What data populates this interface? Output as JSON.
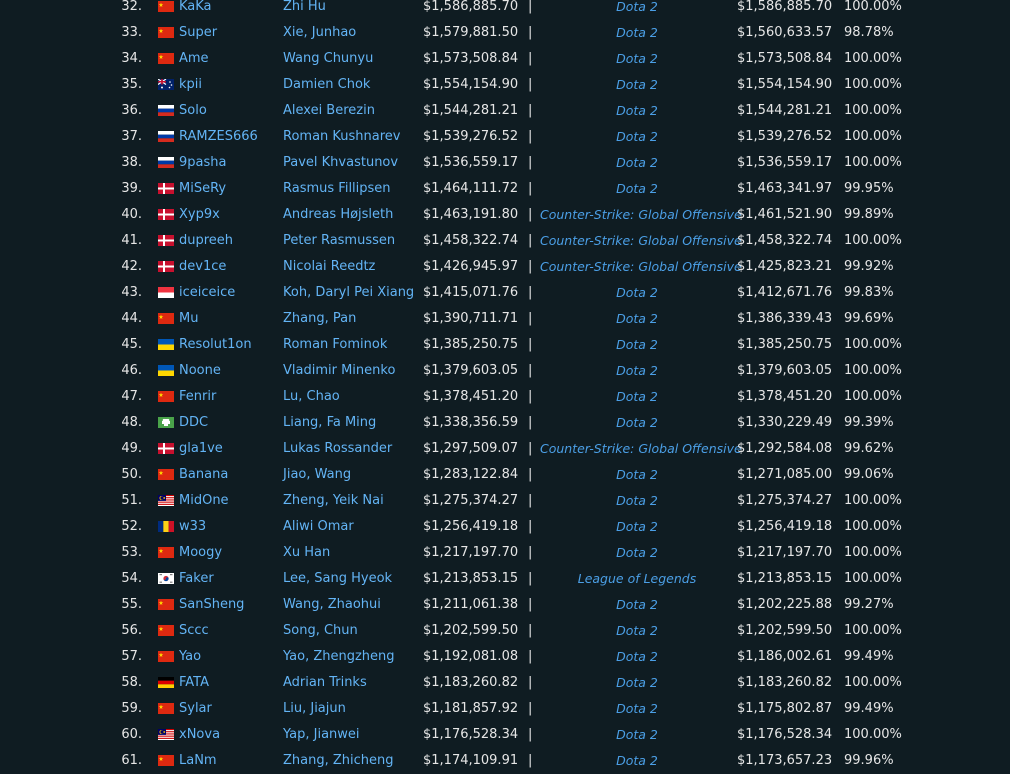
{
  "separator": "|",
  "players": [
    {
      "rank": "32.",
      "country": "cn",
      "handle": "KaKa",
      "name": "Zhi Hu",
      "total": "$1,586,885.70",
      "game": "Dota 2",
      "game_earnings": "$1,586,885.70",
      "percent": "100.00%"
    },
    {
      "rank": "33.",
      "country": "cn",
      "handle": "Super",
      "name": "Xie, Junhao",
      "total": "$1,579,881.50",
      "game": "Dota 2",
      "game_earnings": "$1,560,633.57",
      "percent": "98.78%"
    },
    {
      "rank": "34.",
      "country": "cn",
      "handle": "Ame",
      "name": "Wang Chunyu",
      "total": "$1,573,508.84",
      "game": "Dota 2",
      "game_earnings": "$1,573,508.84",
      "percent": "100.00%"
    },
    {
      "rank": "35.",
      "country": "au",
      "handle": "kpii",
      "name": "Damien Chok",
      "total": "$1,554,154.90",
      "game": "Dota 2",
      "game_earnings": "$1,554,154.90",
      "percent": "100.00%"
    },
    {
      "rank": "36.",
      "country": "ru",
      "handle": "Solo",
      "name": "Alexei Berezin",
      "total": "$1,544,281.21",
      "game": "Dota 2",
      "game_earnings": "$1,544,281.21",
      "percent": "100.00%"
    },
    {
      "rank": "37.",
      "country": "ru",
      "handle": "RAMZES666",
      "name": "Roman Kushnarev",
      "total": "$1,539,276.52",
      "game": "Dota 2",
      "game_earnings": "$1,539,276.52",
      "percent": "100.00%"
    },
    {
      "rank": "38.",
      "country": "ru",
      "handle": "9pasha",
      "name": "Pavel Khvastunov",
      "total": "$1,536,559.17",
      "game": "Dota 2",
      "game_earnings": "$1,536,559.17",
      "percent": "100.00%"
    },
    {
      "rank": "39.",
      "country": "dk",
      "handle": "MiSeRy",
      "name": "Rasmus Fillipsen",
      "total": "$1,464,111.72",
      "game": "Dota 2",
      "game_earnings": "$1,463,341.97",
      "percent": "99.95%"
    },
    {
      "rank": "40.",
      "country": "dk",
      "handle": "Xyp9x",
      "name": "Andreas Højsleth",
      "total": "$1,463,191.80",
      "game": "Counter-Strike: Global Offensive",
      "game_earnings": "$1,461,521.90",
      "percent": "99.89%"
    },
    {
      "rank": "41.",
      "country": "dk",
      "handle": "dupreeh",
      "name": "Peter Rasmussen",
      "total": "$1,458,322.74",
      "game": "Counter-Strike: Global Offensive",
      "game_earnings": "$1,458,322.74",
      "percent": "100.00%"
    },
    {
      "rank": "42.",
      "country": "dk",
      "handle": "dev1ce",
      "name": "Nicolai Reedtz",
      "total": "$1,426,945.97",
      "game": "Counter-Strike: Global Offensive",
      "game_earnings": "$1,425,823.21",
      "percent": "99.92%"
    },
    {
      "rank": "43.",
      "country": "sg",
      "handle": "iceiceice",
      "name": "Koh, Daryl Pei Xiang",
      "total": "$1,415,071.76",
      "game": "Dota 2",
      "game_earnings": "$1,412,671.76",
      "percent": "99.83%"
    },
    {
      "rank": "44.",
      "country": "cn",
      "handle": "Mu",
      "name": "Zhang, Pan",
      "total": "$1,390,711.71",
      "game": "Dota 2",
      "game_earnings": "$1,386,339.43",
      "percent": "99.69%"
    },
    {
      "rank": "45.",
      "country": "ua",
      "handle": "Resolut1on",
      "name": "Roman Fominok",
      "total": "$1,385,250.75",
      "game": "Dota 2",
      "game_earnings": "$1,385,250.75",
      "percent": "100.00%"
    },
    {
      "rank": "46.",
      "country": "ua",
      "handle": "Noone",
      "name": "Vladimir Minenko",
      "total": "$1,379,603.05",
      "game": "Dota 2",
      "game_earnings": "$1,379,603.05",
      "percent": "100.00%"
    },
    {
      "rank": "47.",
      "country": "cn",
      "handle": "Fenrir",
      "name": "Lu, Chao",
      "total": "$1,378,451.20",
      "game": "Dota 2",
      "game_earnings": "$1,378,451.20",
      "percent": "100.00%"
    },
    {
      "rank": "48.",
      "country": "unknown",
      "handle": "DDC",
      "name": "Liang, Fa Ming",
      "total": "$1,338,356.59",
      "game": "Dota 2",
      "game_earnings": "$1,330,229.49",
      "percent": "99.39%"
    },
    {
      "rank": "49.",
      "country": "dk",
      "handle": "gla1ve",
      "name": "Lukas Rossander",
      "total": "$1,297,509.07",
      "game": "Counter-Strike: Global Offensive",
      "game_earnings": "$1,292,584.08",
      "percent": "99.62%"
    },
    {
      "rank": "50.",
      "country": "cn",
      "handle": "Banana",
      "name": "Jiao, Wang",
      "total": "$1,283,122.84",
      "game": "Dota 2",
      "game_earnings": "$1,271,085.00",
      "percent": "99.06%"
    },
    {
      "rank": "51.",
      "country": "my",
      "handle": "MidOne",
      "name": "Zheng, Yeik Nai",
      "total": "$1,275,374.27",
      "game": "Dota 2",
      "game_earnings": "$1,275,374.27",
      "percent": "100.00%"
    },
    {
      "rank": "52.",
      "country": "ro",
      "handle": "w33",
      "name": "Aliwi Omar",
      "total": "$1,256,419.18",
      "game": "Dota 2",
      "game_earnings": "$1,256,419.18",
      "percent": "100.00%"
    },
    {
      "rank": "53.",
      "country": "cn",
      "handle": "Moogy",
      "name": "Xu Han",
      "total": "$1,217,197.70",
      "game": "Dota 2",
      "game_earnings": "$1,217,197.70",
      "percent": "100.00%"
    },
    {
      "rank": "54.",
      "country": "kr",
      "handle": "Faker",
      "name": "Lee, Sang Hyeok",
      "total": "$1,213,853.15",
      "game": "League of Legends",
      "game_earnings": "$1,213,853.15",
      "percent": "100.00%"
    },
    {
      "rank": "55.",
      "country": "cn",
      "handle": "SanSheng",
      "name": "Wang, Zhaohui",
      "total": "$1,211,061.38",
      "game": "Dota 2",
      "game_earnings": "$1,202,225.88",
      "percent": "99.27%"
    },
    {
      "rank": "56.",
      "country": "cn",
      "handle": "Sccc",
      "name": "Song, Chun",
      "total": "$1,202,599.50",
      "game": "Dota 2",
      "game_earnings": "$1,202,599.50",
      "percent": "100.00%"
    },
    {
      "rank": "57.",
      "country": "cn",
      "handle": "Yao",
      "name": "Yao, Zhengzheng",
      "total": "$1,192,081.08",
      "game": "Dota 2",
      "game_earnings": "$1,186,002.61",
      "percent": "99.49%"
    },
    {
      "rank": "58.",
      "country": "de",
      "handle": "FATA",
      "name": "Adrian Trinks",
      "total": "$1,183,260.82",
      "game": "Dota 2",
      "game_earnings": "$1,183,260.82",
      "percent": "100.00%"
    },
    {
      "rank": "59.",
      "country": "cn",
      "handle": "Sylar",
      "name": "Liu, Jiajun",
      "total": "$1,181,857.92",
      "game": "Dota 2",
      "game_earnings": "$1,175,802.87",
      "percent": "99.49%"
    },
    {
      "rank": "60.",
      "country": "my",
      "handle": "xNova",
      "name": "Yap, Jianwei",
      "total": "$1,176,528.34",
      "game": "Dota 2",
      "game_earnings": "$1,176,528.34",
      "percent": "100.00%"
    },
    {
      "rank": "61.",
      "country": "cn",
      "handle": "LaNm",
      "name": "Zhang, Zhicheng",
      "total": "$1,174,109.91",
      "game": "Dota 2",
      "game_earnings": "$1,173,657.23",
      "percent": "99.96%"
    }
  ]
}
